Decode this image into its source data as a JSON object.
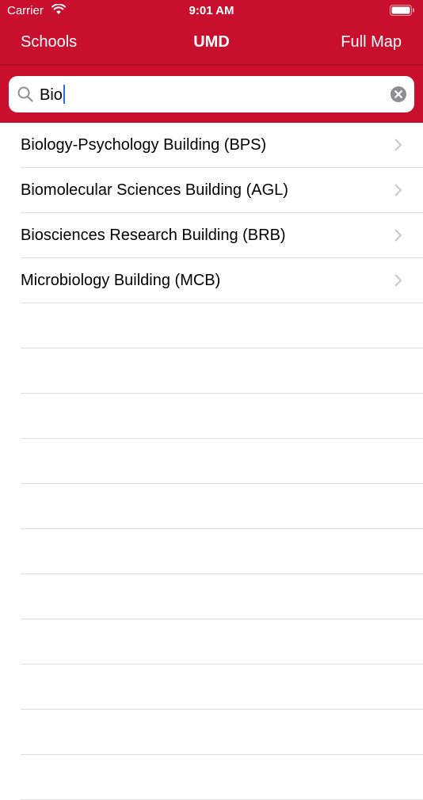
{
  "status_bar": {
    "carrier": "Carrier",
    "time": "9:01 AM"
  },
  "nav": {
    "left_label": "Schools",
    "title": "UMD",
    "right_label": "Full Map"
  },
  "search": {
    "value": "Bio",
    "icon": "search-icon",
    "clear_icon": "clear-icon"
  },
  "results": [
    {
      "label": "Biology-Psychology Building (BPS)"
    },
    {
      "label": "Biomolecular Sciences Building (AGL)"
    },
    {
      "label": "Biosciences Research Building (BRB)"
    },
    {
      "label": "Microbiology Building (MCB)"
    }
  ],
  "colors": {
    "brand": "#c8102e",
    "separator": "#dcdcdc",
    "chevron": "#c7c7cc",
    "caret": "#2f6fd4"
  }
}
